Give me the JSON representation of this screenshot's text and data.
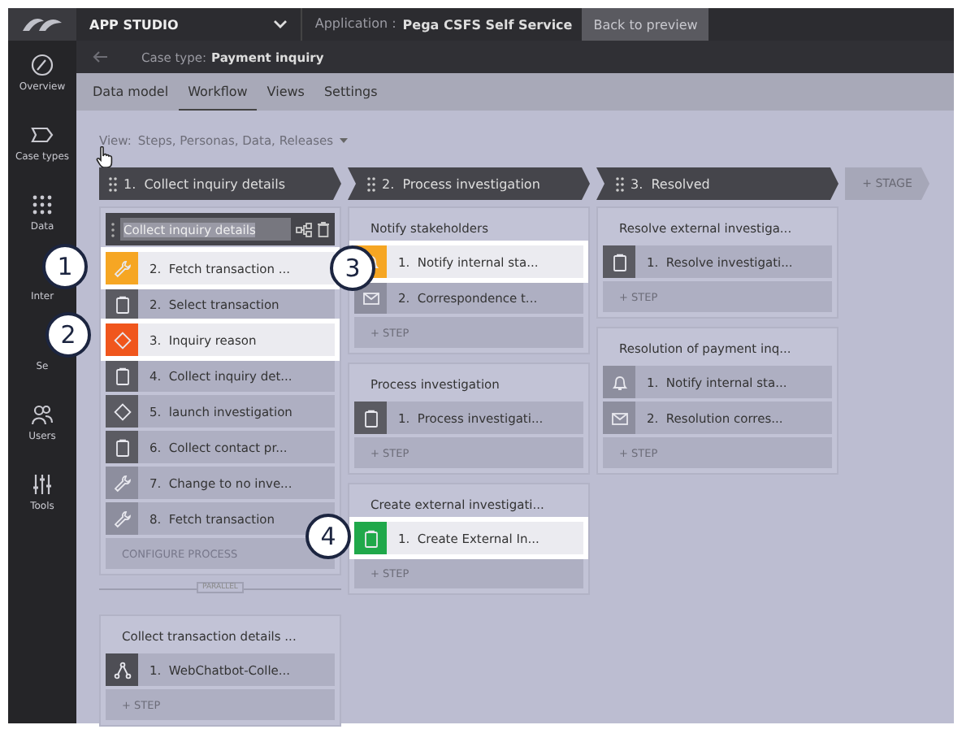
{
  "topbar": {
    "title": "APP STUDIO",
    "application_label": "Application :",
    "application_name": "Pega CSFS Self Service",
    "back_button": "Back to preview"
  },
  "sidebar": {
    "items": [
      {
        "label": "Overview"
      },
      {
        "label": "Case types"
      },
      {
        "label": "Data"
      },
      {
        "label": "Inter"
      },
      {
        "label": "Se"
      },
      {
        "label": "Users"
      },
      {
        "label": "Tools"
      }
    ]
  },
  "case_bar": {
    "label": "Case type:",
    "value": "Payment inquiry"
  },
  "tabs": [
    {
      "label": "Data model",
      "selected": false
    },
    {
      "label": "Workflow",
      "selected": true
    },
    {
      "label": "Views",
      "selected": false
    },
    {
      "label": "Settings",
      "selected": false
    }
  ],
  "view": {
    "label": "View:",
    "value": "Steps, Personas, Data, Releases"
  },
  "stages": [
    {
      "number": "1.",
      "title": "Collect inquiry details",
      "processes": [
        {
          "title": "Collect inquiry details",
          "editing": true,
          "action": "CONFIGURE PROCESS",
          "steps": [
            {
              "number": "2.",
              "label": "Fetch transaction ...",
              "kind": "utility",
              "highlighted": true,
              "color": "#f6a623"
            },
            {
              "number": "2.",
              "label": "Select transaction",
              "kind": "collect",
              "highlighted": false
            },
            {
              "number": "3.",
              "label": "Inquiry reason",
              "kind": "decision",
              "highlighted": true,
              "color": "#f0561d"
            },
            {
              "number": "4.",
              "label": "Collect inquiry det...",
              "kind": "collect",
              "highlighted": false
            },
            {
              "number": "5.",
              "label": "launch investigation",
              "kind": "decision",
              "highlighted": false
            },
            {
              "number": "6.",
              "label": "Collect contact pr...",
              "kind": "collect",
              "highlighted": false
            },
            {
              "number": "7.",
              "label": "Change to no inve...",
              "kind": "utility",
              "highlighted": false
            },
            {
              "number": "8.",
              "label": "Fetch transaction",
              "kind": "utility",
              "highlighted": false
            }
          ]
        },
        {
          "title": "Collect transaction details ...",
          "editing": false,
          "connector": "PARALLEL",
          "action": "+ STEP",
          "steps": [
            {
              "number": "1.",
              "label": "WebChatbot-Colle...",
              "kind": "subprocess",
              "highlighted": false
            }
          ]
        }
      ]
    },
    {
      "number": "2.",
      "title": "Process investigation",
      "processes": [
        {
          "title": "Notify stakeholders",
          "editing": false,
          "action": "+ STEP",
          "steps": [
            {
              "number": "1.",
              "label": "Notify internal sta...",
              "kind": "notify",
              "highlighted": true,
              "color": "#f6a623"
            },
            {
              "number": "2.",
              "label": "Correspondence t...",
              "kind": "email",
              "highlighted": false
            }
          ]
        },
        {
          "title": "Process investigation",
          "editing": false,
          "action": "+ STEP",
          "steps": [
            {
              "number": "1.",
              "label": "Process investigati...",
              "kind": "collect",
              "highlighted": false
            }
          ]
        },
        {
          "title": "Create external investigati...",
          "editing": false,
          "action": "+ STEP",
          "steps": [
            {
              "number": "1.",
              "label": "Create External In...",
              "kind": "collect",
              "highlighted": true,
              "color": "#1fa84a"
            }
          ]
        }
      ]
    },
    {
      "number": "3.",
      "title": "Resolved",
      "processes": [
        {
          "title": "Resolve external investiga...",
          "editing": false,
          "action": "+ STEP",
          "steps": [
            {
              "number": "1.",
              "label": "Resolve investigati...",
              "kind": "collect",
              "highlighted": false
            }
          ]
        },
        {
          "title": "Resolution of payment inq...",
          "editing": false,
          "action": "+ STEP",
          "steps": [
            {
              "number": "1.",
              "label": "Notify internal sta...",
              "kind": "notify",
              "highlighted": false
            },
            {
              "number": "2.",
              "label": "Resolution corres...",
              "kind": "email",
              "highlighted": false
            }
          ]
        }
      ]
    }
  ],
  "add_stage": "+ STAGE",
  "callouts": [
    {
      "label": "1"
    },
    {
      "label": "2"
    },
    {
      "label": "3"
    },
    {
      "label": "4"
    }
  ]
}
